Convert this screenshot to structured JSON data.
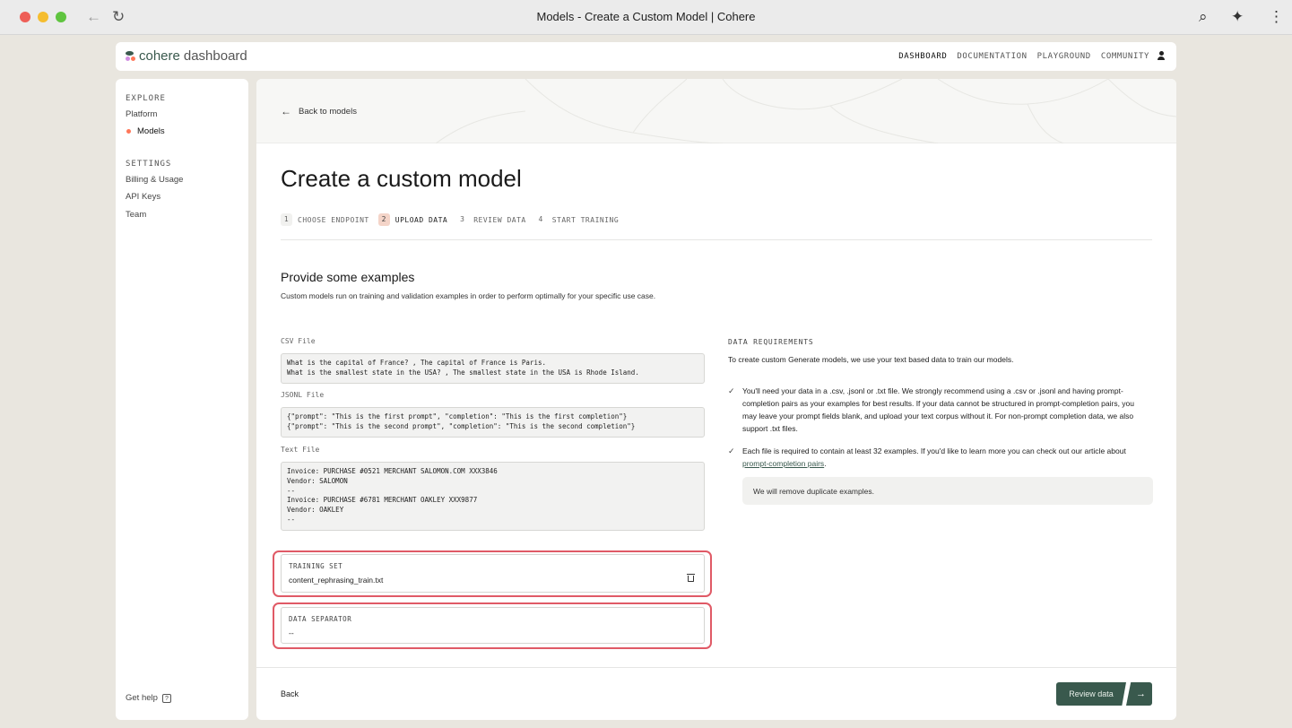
{
  "browser": {
    "title": "Models - Create a Custom Model | Cohere"
  },
  "topnav": {
    "logo_word": "cohere",
    "logo_suffix": "dashboard",
    "links": [
      "DASHBOARD",
      "DOCUMENTATION",
      "PLAYGROUND",
      "COMMUNITY"
    ],
    "active_link": "DASHBOARD"
  },
  "sidebar": {
    "explore_heading": "EXPLORE",
    "explore_items": [
      "Platform",
      "Models"
    ],
    "active_item": "Models",
    "settings_heading": "SETTINGS",
    "settings_items": [
      "Billing & Usage",
      "API Keys",
      "Team"
    ],
    "help_label": "Get help",
    "help_icon": "?"
  },
  "main": {
    "back_to_models": "Back to models",
    "title": "Create a custom model",
    "steps": [
      {
        "num": "1",
        "label": "CHOOSE ENDPOINT"
      },
      {
        "num": "2",
        "label": "UPLOAD DATA"
      },
      {
        "num": "3",
        "label": "REVIEW DATA"
      },
      {
        "num": "4",
        "label": "START TRAINING"
      }
    ],
    "active_step": "2",
    "section_title": "Provide some examples",
    "section_subtitle": "Custom models run on training and validation examples in order to perform optimally for your specific use case.",
    "examples": {
      "csv_label": "CSV File",
      "csv_text": "What is the capital of France? , The capital of France is Paris.\nWhat is the smallest state in the USA? , The smallest state in the USA is Rhode Island.",
      "jsonl_label": "JSONL File",
      "jsonl_text": "{\"prompt\": \"This is the first prompt\", \"completion\": \"This is the first completion\"}\n{\"prompt\": \"This is the second prompt\", \"completion\": \"This is the second completion\"}",
      "text_label": "Text File",
      "text_text": "Invoice: PURCHASE #0521 MERCHANT SALOMON.COM XXX3846\nVendor: SALOMON\n--\nInvoice: PURCHASE #6781 MERCHANT OAKLEY XXX9877\nVendor: OAKLEY\n--"
    },
    "training_set": {
      "label": "TRAINING SET",
      "value": "content_rephrasing_train.txt"
    },
    "data_separator": {
      "label": "DATA SEPARATOR",
      "value": "--"
    },
    "requirements": {
      "heading": "DATA REQUIREMENTS",
      "subtitle": "To create custom Generate models, we use your text based data to train our models.",
      "item1": "You'll need your data in a .csv, .jsonl or .txt file. We strongly recommend using a .csv or .jsonl and having prompt-completion pairs as your examples for best results. If your data cannot be structured in prompt-completion pairs, you may leave your prompt fields blank, and upload your text corpus without it. For non-prompt completion data, we also support .txt files.",
      "item2_prefix": "Each file is required to contain at least 32 examples. If you'd like to learn more you can check out our article about ",
      "item2_link": "prompt-completion pairs",
      "item2_suffix": ".",
      "note": "We will remove duplicate examples.",
      "check_glyph": "✓"
    },
    "footer": {
      "back_label": "Back",
      "review_label": "Review data",
      "arrow_glyph": "→"
    }
  },
  "colors": {
    "brand": "#39594d",
    "accent": "#ff7759",
    "highlight": "#e05a66"
  }
}
